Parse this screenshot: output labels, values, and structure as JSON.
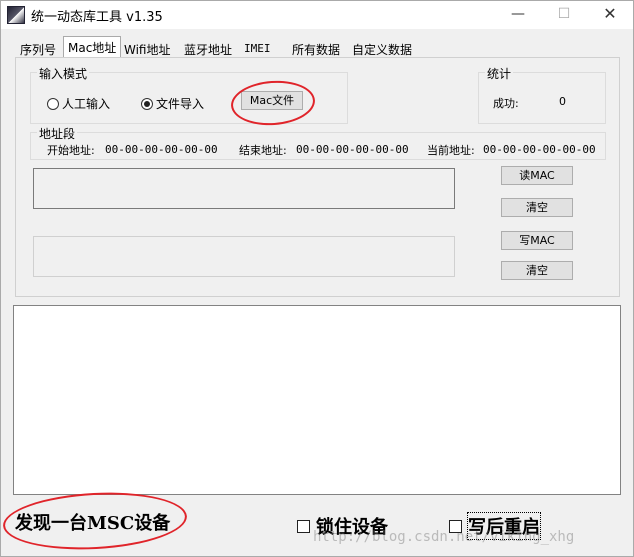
{
  "window": {
    "title": "统一动态库工具 v1.35",
    "min_glyph": "—",
    "max_glyph": "☐",
    "close_glyph": "✕"
  },
  "tabs": [
    {
      "label": "序列号",
      "active": false
    },
    {
      "label": "Mac地址",
      "active": true
    },
    {
      "label": "Wifi地址",
      "active": false
    },
    {
      "label": "蓝牙地址",
      "active": false
    },
    {
      "label": "IMEI",
      "active": false
    },
    {
      "label": "所有数据",
      "active": false
    },
    {
      "label": "自定义数据",
      "active": false
    }
  ],
  "input_mode": {
    "title": "输入模式",
    "manual_label": "人工输入",
    "file_label": "文件导入",
    "selected": "file",
    "mac_file_button": "Mac文件"
  },
  "stats": {
    "title": "统计",
    "success_label": "成功:",
    "success_value": "0"
  },
  "address_range": {
    "title": "地址段",
    "start_label": "开始地址:",
    "start_value": "00-00-00-00-00-00",
    "end_label": "结束地址:",
    "end_value": "00-00-00-00-00-00",
    "current_label": "当前地址:",
    "current_value": "00-00-00-00-00-00"
  },
  "buttons": {
    "read_mac": "读MAC",
    "clear1": "清空",
    "write_mac": "写MAC",
    "clear2": "清空"
  },
  "footer": {
    "status": "发现一台MSC设备",
    "lock_device": "锁住设备",
    "reboot_after_write": "写后重启"
  },
  "watermark": "http://blog.csdn.net/viking_xhg",
  "colors": {
    "annotation": "#e0242a",
    "window_bg": "#f0f0f0"
  }
}
